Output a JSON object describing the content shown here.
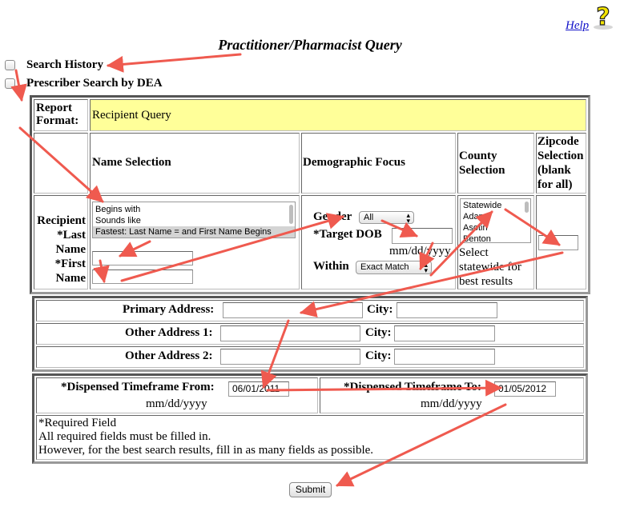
{
  "header": {
    "help_link": "Help",
    "title": "Practitioner/Pharmacist Query"
  },
  "options": {
    "search_history": "Search History",
    "prescriber_search": "Prescriber Search by DEA"
  },
  "report": {
    "label_line1": "Report",
    "label_line2": "Format:",
    "value": "Recipient Query"
  },
  "columns": {
    "name_selection": "Name Selection",
    "demographic_focus": "Demographic Focus",
    "county_line1": "County",
    "county_line2": "Selection",
    "zip_line1": "Zipcode",
    "zip_line2": "Selection",
    "zip_line3": "(blank",
    "zip_line4": "for all)"
  },
  "recipient_label": {
    "l1": "Recipient",
    "l2": "*Last",
    "l3": "Name",
    "l4": "*First",
    "l5": "Name"
  },
  "name_options": [
    "Begins with",
    "Sounds like",
    "Fastest: Last Name = and First Name Begins"
  ],
  "name_selected_index": 2,
  "demographic": {
    "gender_label": "Gender",
    "gender_value": "All",
    "dob_label": "*Target DOB",
    "dob_hint": "mm/dd/yyyy",
    "within_label": "Within",
    "within_value": "Exact Match"
  },
  "county": {
    "options": [
      "Statewide",
      "Adams",
      "Asotin",
      "Benton"
    ],
    "hint1": "Select",
    "hint2": "statewide for",
    "hint3": "best results"
  },
  "address": {
    "primary_label": "Primary Address:",
    "other1_label": "Other Address 1:",
    "other2_label": "Other Address 2:",
    "city_label": "City:"
  },
  "timeframe": {
    "from_label": "*Dispensed Timeframe From:",
    "from_value": "06/01/2011",
    "to_label": "*Dispensed Timeframe To:",
    "to_value": "01/05/2012",
    "date_hint": "mm/dd/yyyy"
  },
  "notes": {
    "line1": "*Required Field",
    "line2": "All required fields must be filled in.",
    "line3": "However, for the best search results, fill in as many fields as possible."
  },
  "submit_label": "Submit",
  "colors": {
    "report_bg": "#ffff99",
    "arrow": "#ef5a4f",
    "link": "#1010c8"
  }
}
